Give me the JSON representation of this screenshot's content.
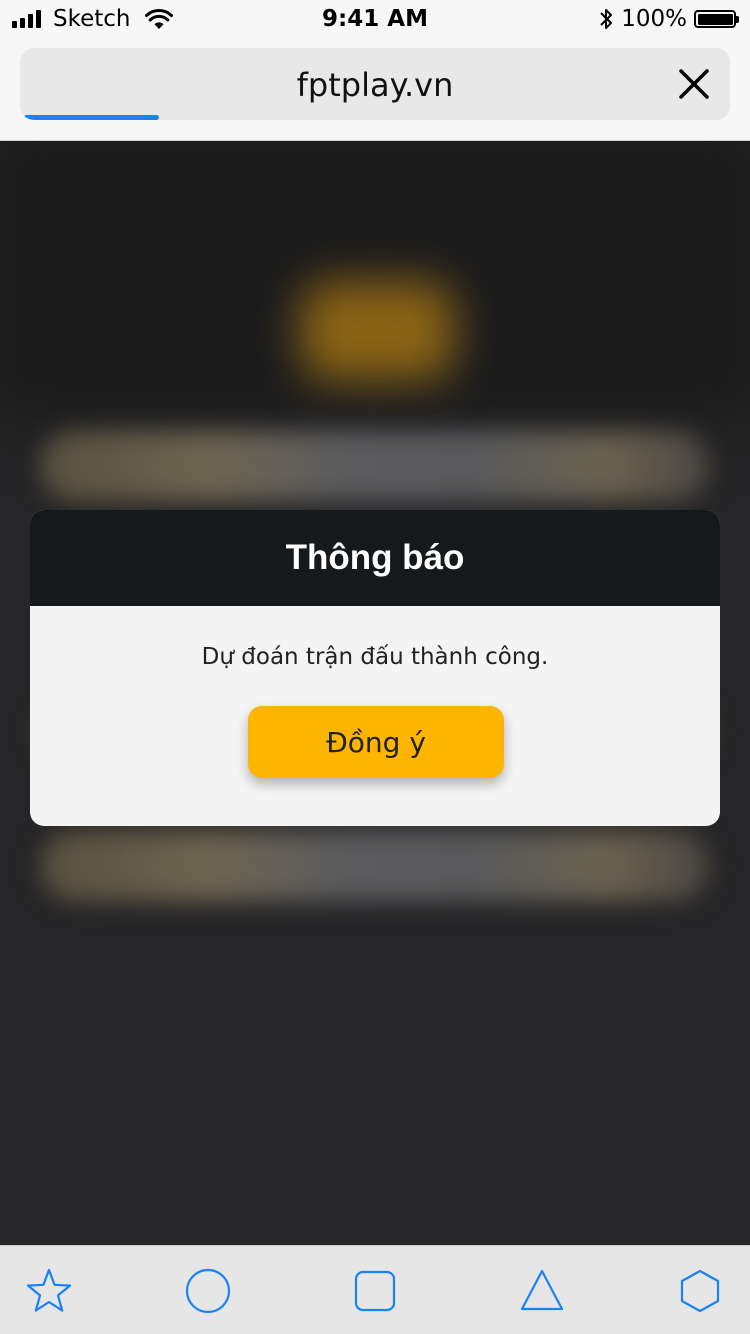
{
  "status_bar": {
    "carrier": "Sketch",
    "time": "9:41 AM",
    "battery_percent": "100%",
    "battery_level": 1.0
  },
  "address_bar": {
    "url": "fptplay.vn",
    "close_icon": "close-icon",
    "load_progress": 0.19,
    "progress_color": "#1a82f7"
  },
  "dialog": {
    "title": "Thông báo",
    "message": "Dự đoán trận đấu thành công.",
    "confirm_label": "Đồng ý",
    "header_color": "#16191b",
    "button_color": "#feb500"
  },
  "toolbar": {
    "icons": [
      "star-icon",
      "circle-icon",
      "square-icon",
      "triangle-icon",
      "hexagon-icon"
    ],
    "accent_color": "#1a82f7"
  }
}
